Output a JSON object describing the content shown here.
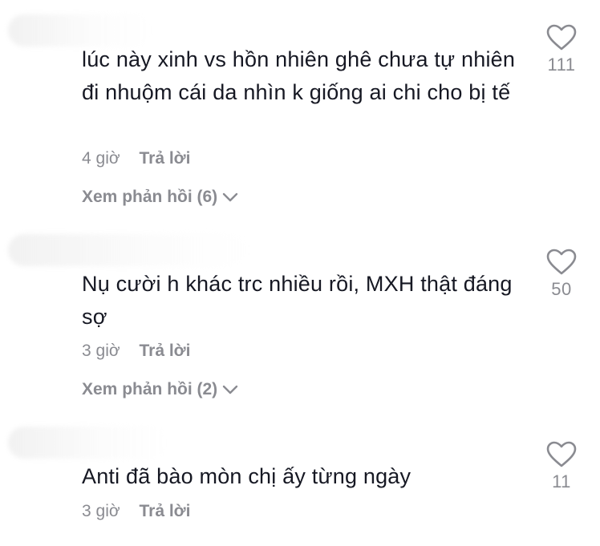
{
  "comments": [
    {
      "text": "lúc này xinh vs hồn nhiên ghê chưa tự nhiên đi nhuộm cái da nhìn k giống ai chi cho bị tế",
      "time": "4 giờ",
      "reply_label": "Trả lời",
      "view_replies": "Xem phản hồi (6)",
      "likes": "111"
    },
    {
      "text": "Nụ cười h khác trc nhiều rồi, MXH thật đáng sợ",
      "time": "3 giờ",
      "reply_label": "Trả lời",
      "view_replies": "Xem phản hồi (2)",
      "likes": "50"
    },
    {
      "text": "Anti đã bào mòn chị ấy từng ngày",
      "time": "3 giờ",
      "reply_label": "Trả lời",
      "likes": "11"
    }
  ],
  "icons": {
    "like": "heart-outline-icon",
    "expand": "chevron-down-icon"
  },
  "colors": {
    "text": "#161823",
    "muted": "#8a8b91",
    "background": "#ffffff"
  }
}
